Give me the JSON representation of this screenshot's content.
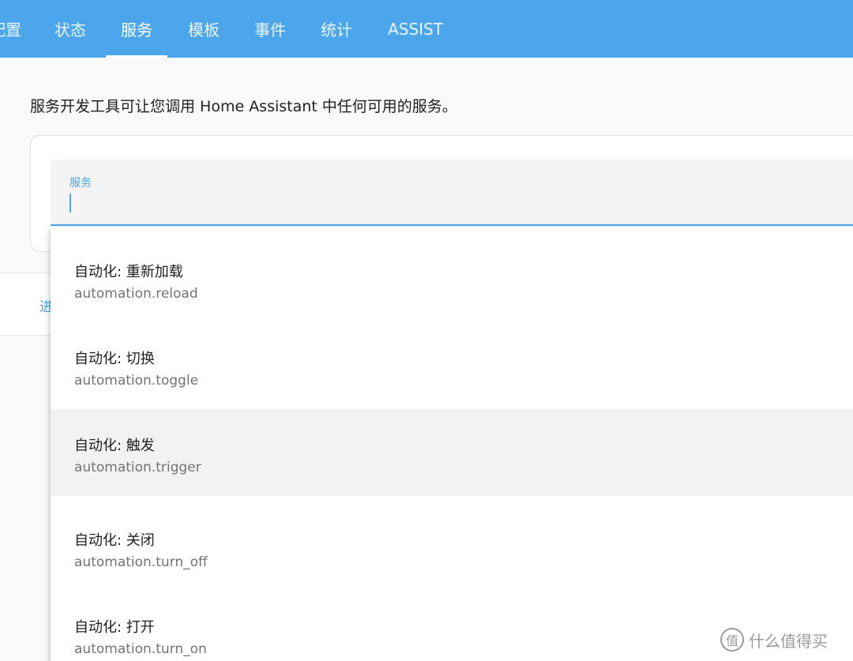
{
  "tabs": [
    {
      "label": "配置",
      "active": false
    },
    {
      "label": "状态",
      "active": false
    },
    {
      "label": "服务",
      "active": true
    },
    {
      "label": "模板",
      "active": false
    },
    {
      "label": "事件",
      "active": false
    },
    {
      "label": "统计",
      "active": false
    },
    {
      "label": "ASSIST",
      "active": false
    }
  ],
  "description": "服务开发工具可让您调用 Home Assistant 中任何可用的服务。",
  "service_field": {
    "label": "服务",
    "value": ""
  },
  "secondary": {
    "partial_text": "进"
  },
  "options": [
    {
      "title": "自动化: 重新加载",
      "service": "automation.reload",
      "highlighted": false
    },
    {
      "title": "自动化: 切换",
      "service": "automation.toggle",
      "highlighted": false
    },
    {
      "title": "自动化: 触发",
      "service": "automation.trigger",
      "highlighted": true
    },
    {
      "title": "自动化: 关闭",
      "service": "automation.turn_off",
      "highlighted": false
    },
    {
      "title": "自动化: 打开",
      "service": "automation.turn_on",
      "highlighted": false
    }
  ],
  "watermark": {
    "icon_char": "值",
    "text": "什么值得买"
  },
  "colors": {
    "accent": "#4ba6ec",
    "highlight_row": "#f2f2f2"
  }
}
